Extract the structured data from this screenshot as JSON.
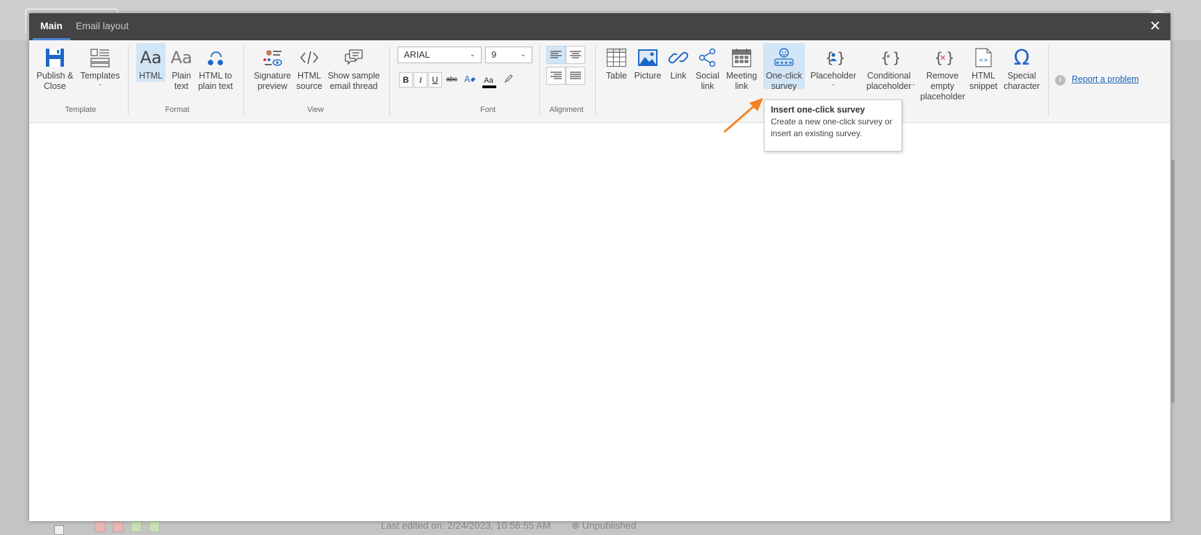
{
  "colors": {
    "accent": "#4a88d8",
    "link": "#1a63b5",
    "arrow": "#f58220",
    "titlebar": "#444444"
  },
  "tabs": [
    {
      "label": "Main",
      "active": true
    },
    {
      "label": "Email layout",
      "active": false
    }
  ],
  "close": {
    "icon": "close-icon",
    "glyph": "✕"
  },
  "groups": {
    "template": "Template",
    "format": "Format",
    "view": "View",
    "font": "Font",
    "alignment": "Alignment"
  },
  "buttons": {
    "publish": "Publish &\nClose",
    "templates": "Templates",
    "html": "HTML",
    "plain_text": "Plain\ntext",
    "html_to_plain": "HTML to\nplain text",
    "signature_preview": "Signature\npreview",
    "html_source": "HTML\nsource",
    "show_sample": "Show sample\nemail thread",
    "table": "Table",
    "picture": "Picture",
    "link": "Link",
    "social_link": "Social\nlink",
    "meeting_link": "Meeting\nlink",
    "one_click_survey": "One-click\nsurvey",
    "placeholder": "Placeholder",
    "conditional_placeholder": "Conditional\nplaceholder",
    "remove_empty": "Remove\nempty\nplaceholder",
    "html_snippet": "HTML\nsnippet",
    "special_character": "Special\ncharacter"
  },
  "font": {
    "family": "ARIAL",
    "size": "9",
    "bold": "B",
    "italic": "I",
    "underline": "U",
    "strike": "abc",
    "font_color": "Aa",
    "font_color_value": "#000000"
  },
  "report": "Report a problem",
  "tooltip": {
    "title": "Insert one-click survey",
    "body": "Create a new one-click survey or insert an existing survey."
  },
  "background": {
    "last_edited": "Last edited on: 2/24/2023, 10:56:55 AM",
    "status": "Unpublished"
  }
}
